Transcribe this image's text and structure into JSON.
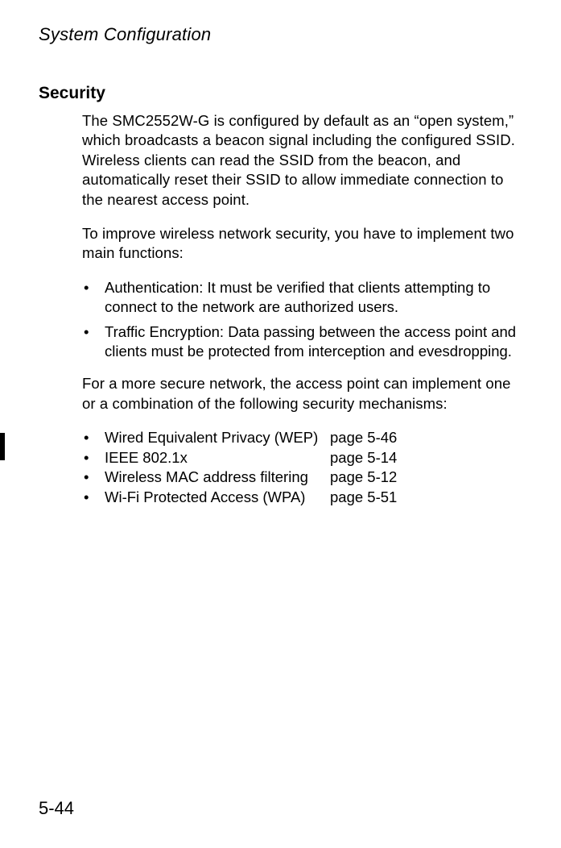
{
  "chapter": "System Configuration",
  "heading": "Security",
  "para1": "The SMC2552W-G is configured by default as an “open system,” which broadcasts a beacon signal including the configured SSID. Wireless clients can read the SSID from the beacon, and automatically reset their SSID to allow immediate connection to the nearest access point.",
  "para2": "To improve wireless network security, you have to implement two main functions:",
  "functions": [
    "Authentication: It must be verified that clients attempting to connect to the network are authorized users.",
    "Traffic Encryption: Data passing between the access point and clients must be protected from interception and evesdropping."
  ],
  "para3": "For a more secure network, the access point can implement one or a combination of the following security mechanisms:",
  "mechanisms": [
    {
      "name": "Wired Equivalent Privacy (WEP)",
      "page": "page 5-46"
    },
    {
      "name": "IEEE 802.1x",
      "page": "page 5-14"
    },
    {
      "name": "Wireless MAC address filtering",
      "page": "page 5-12"
    },
    {
      "name": "Wi-Fi Protected Access (WPA)",
      "page": "page 5-51"
    }
  ],
  "pageNumber": "5-44"
}
